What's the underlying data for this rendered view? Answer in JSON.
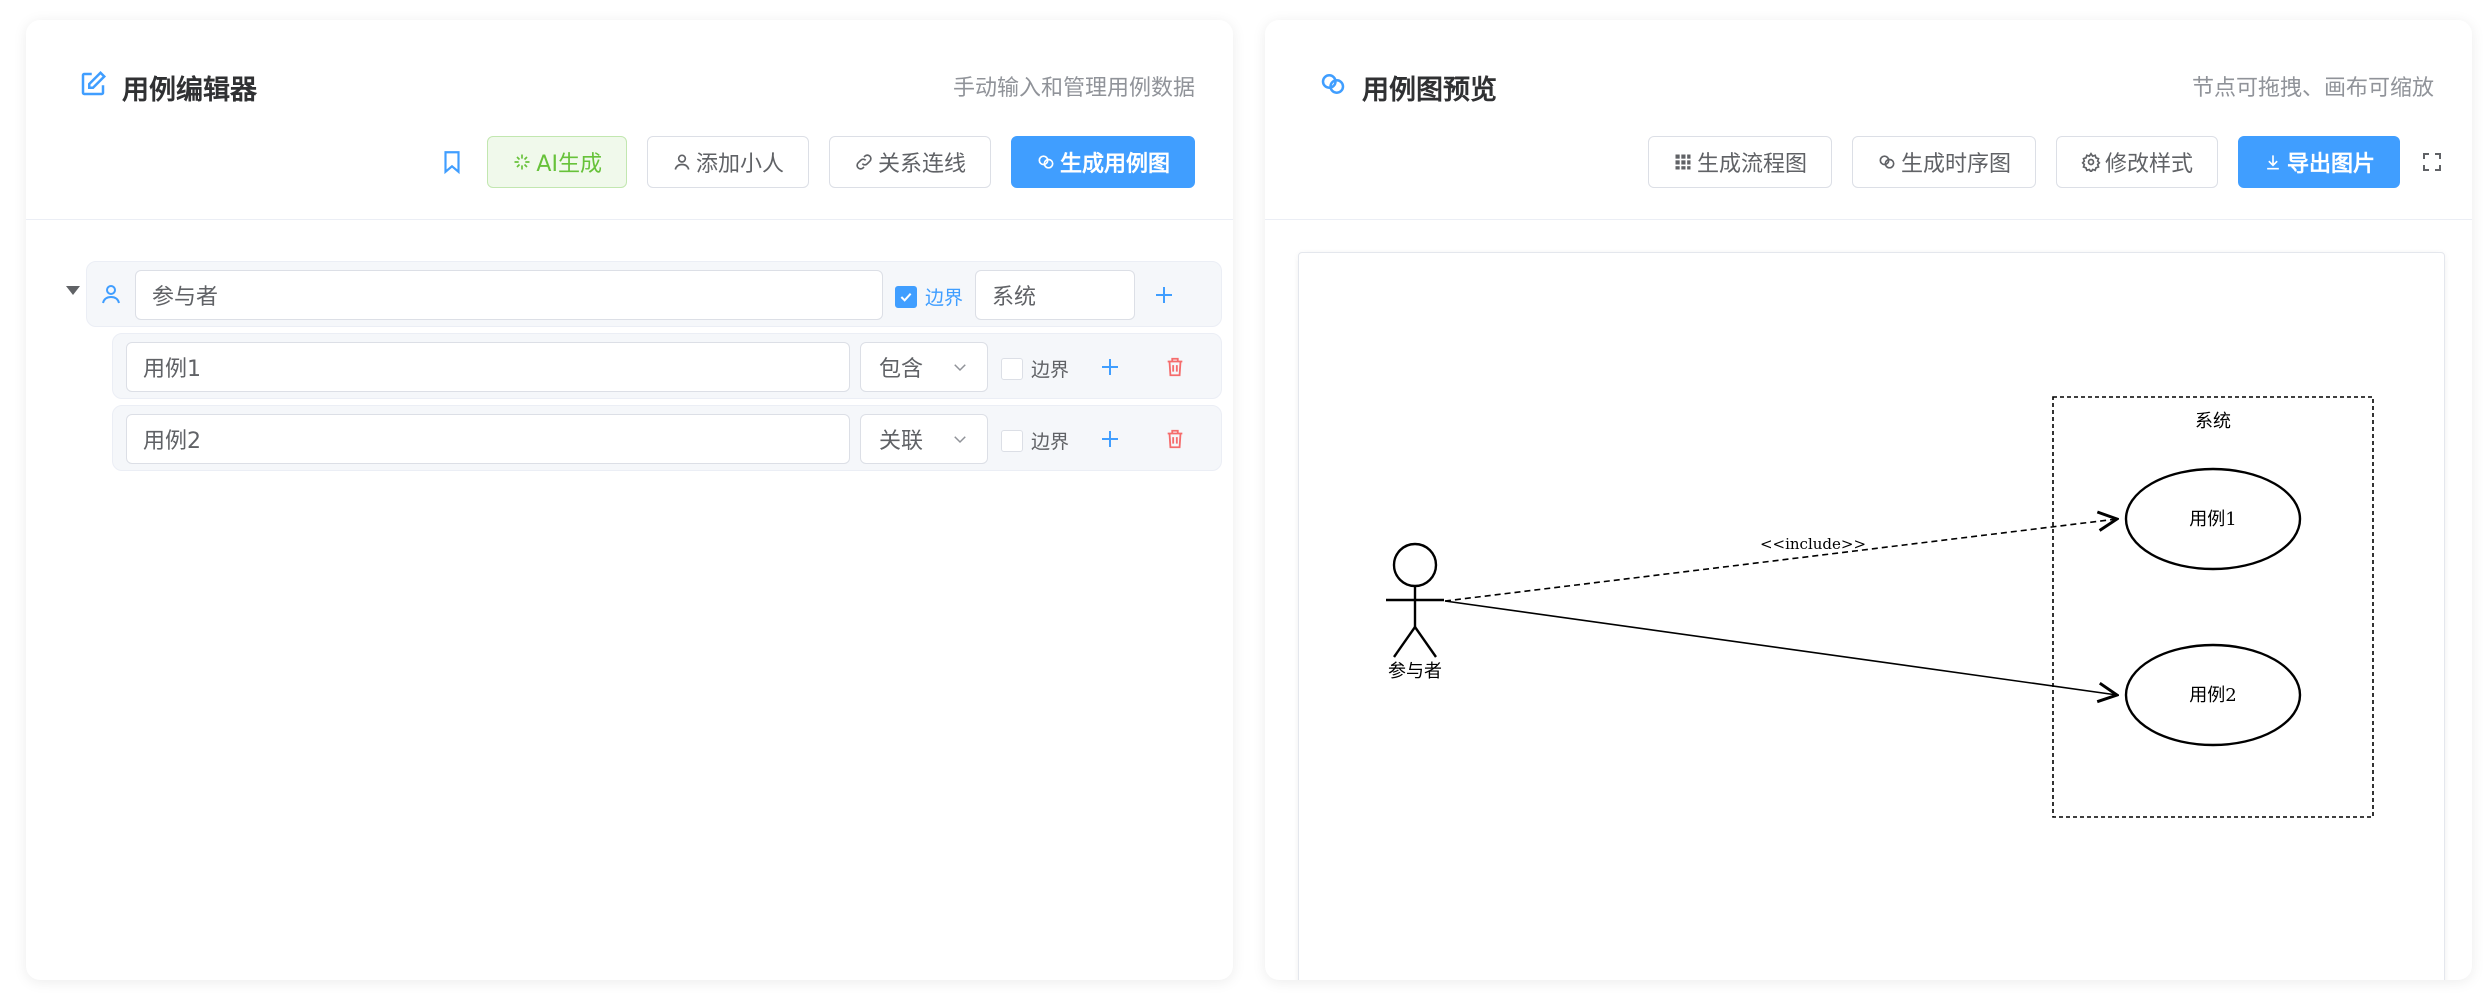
{
  "editor": {
    "title": "用例编辑器",
    "subtitle": "手动输入和管理用例数据",
    "toolbar": {
      "ai_label": "AI生成",
      "add_actor_label": "添加小人",
      "relation_label": "关系连线",
      "generate_label": "生成用例图"
    },
    "actor": {
      "name": "参与者",
      "boundary_label": "边界",
      "boundary_checked": true,
      "system_name": "系统"
    },
    "usecases": [
      {
        "name": "用例1",
        "relation": "包含",
        "boundary_label": "边界",
        "boundary_checked": false
      },
      {
        "name": "用例2",
        "relation": "关联",
        "boundary_label": "边界",
        "boundary_checked": false
      }
    ]
  },
  "preview": {
    "title": "用例图预览",
    "subtitle": "节点可拖拽、画布可缩放",
    "toolbar": {
      "flowchart_label": "生成流程图",
      "sequence_label": "生成时序图",
      "style_label": "修改样式",
      "export_label": "导出图片"
    },
    "diagram": {
      "system_label": "系统",
      "actor_label": "参与者",
      "usecase1_label": "用例1",
      "usecase2_label": "用例2",
      "include_label": "<<include>>"
    }
  },
  "colors": {
    "primary": "#409eff",
    "success": "#67c23a",
    "danger": "#f56c6c",
    "text": "#303133",
    "muted": "#909399"
  }
}
